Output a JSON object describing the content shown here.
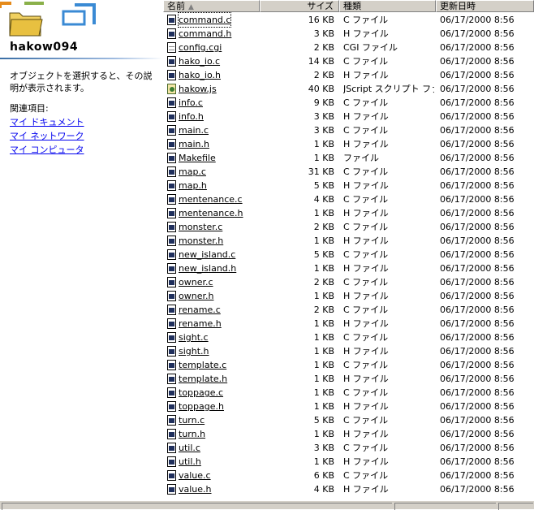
{
  "sidebar": {
    "folder_name": "hakow094",
    "hint": "オブジェクトを選択すると、その説明が表示されます。",
    "related_label": "関連項目:",
    "links": [
      "マイ ドキュメント",
      "マイ ネットワーク",
      "マイ コンピュータ"
    ]
  },
  "list": {
    "headers": {
      "name": "名前",
      "size": "サイズ",
      "type": "種類",
      "date": "更新日時"
    },
    "files": [
      {
        "name": "command.c",
        "size": "16 KB",
        "type": "C ファイル",
        "date": "06/17/2000 8:56",
        "icon": "doc"
      },
      {
        "name": "command.h",
        "size": "3 KB",
        "type": "H ファイル",
        "date": "06/17/2000 8:56",
        "icon": "doc"
      },
      {
        "name": "config.cgi",
        "size": "2 KB",
        "type": "CGI ファイル",
        "date": "06/17/2000 8:56",
        "icon": "plain"
      },
      {
        "name": "hako_io.c",
        "size": "14 KB",
        "type": "C ファイル",
        "date": "06/17/2000 8:56",
        "icon": "doc"
      },
      {
        "name": "hako_io.h",
        "size": "2 KB",
        "type": "H ファイル",
        "date": "06/17/2000 8:56",
        "icon": "doc"
      },
      {
        "name": "hakow.js",
        "size": "40 KB",
        "type": "JScript スクリプト ファ...",
        "date": "06/17/2000 8:56",
        "icon": "script"
      },
      {
        "name": "info.c",
        "size": "9 KB",
        "type": "C ファイル",
        "date": "06/17/2000 8:56",
        "icon": "doc"
      },
      {
        "name": "info.h",
        "size": "3 KB",
        "type": "H ファイル",
        "date": "06/17/2000 8:56",
        "icon": "doc"
      },
      {
        "name": "main.c",
        "size": "3 KB",
        "type": "C ファイル",
        "date": "06/17/2000 8:56",
        "icon": "doc"
      },
      {
        "name": "main.h",
        "size": "1 KB",
        "type": "H ファイル",
        "date": "06/17/2000 8:56",
        "icon": "doc"
      },
      {
        "name": "Makefile",
        "size": "1 KB",
        "type": "ファイル",
        "date": "06/17/2000 8:56",
        "icon": "doc"
      },
      {
        "name": "map.c",
        "size": "31 KB",
        "type": "C ファイル",
        "date": "06/17/2000 8:56",
        "icon": "doc"
      },
      {
        "name": "map.h",
        "size": "5 KB",
        "type": "H ファイル",
        "date": "06/17/2000 8:56",
        "icon": "doc"
      },
      {
        "name": "mentenance.c",
        "size": "4 KB",
        "type": "C ファイル",
        "date": "06/17/2000 8:56",
        "icon": "doc"
      },
      {
        "name": "mentenance.h",
        "size": "1 KB",
        "type": "H ファイル",
        "date": "06/17/2000 8:56",
        "icon": "doc"
      },
      {
        "name": "monster.c",
        "size": "2 KB",
        "type": "C ファイル",
        "date": "06/17/2000 8:56",
        "icon": "doc"
      },
      {
        "name": "monster.h",
        "size": "1 KB",
        "type": "H ファイル",
        "date": "06/17/2000 8:56",
        "icon": "doc"
      },
      {
        "name": "new_island.c",
        "size": "5 KB",
        "type": "C ファイル",
        "date": "06/17/2000 8:56",
        "icon": "doc"
      },
      {
        "name": "new_island.h",
        "size": "1 KB",
        "type": "H ファイル",
        "date": "06/17/2000 8:56",
        "icon": "doc"
      },
      {
        "name": "owner.c",
        "size": "2 KB",
        "type": "C ファイル",
        "date": "06/17/2000 8:56",
        "icon": "doc"
      },
      {
        "name": "owner.h",
        "size": "1 KB",
        "type": "H ファイル",
        "date": "06/17/2000 8:56",
        "icon": "doc"
      },
      {
        "name": "rename.c",
        "size": "2 KB",
        "type": "C ファイル",
        "date": "06/17/2000 8:56",
        "icon": "doc"
      },
      {
        "name": "rename.h",
        "size": "1 KB",
        "type": "H ファイル",
        "date": "06/17/2000 8:56",
        "icon": "doc"
      },
      {
        "name": "sight.c",
        "size": "1 KB",
        "type": "C ファイル",
        "date": "06/17/2000 8:56",
        "icon": "doc"
      },
      {
        "name": "sight.h",
        "size": "1 KB",
        "type": "H ファイル",
        "date": "06/17/2000 8:56",
        "icon": "doc"
      },
      {
        "name": "template.c",
        "size": "1 KB",
        "type": "C ファイル",
        "date": "06/17/2000 8:56",
        "icon": "doc"
      },
      {
        "name": "template.h",
        "size": "1 KB",
        "type": "H ファイル",
        "date": "06/17/2000 8:56",
        "icon": "doc"
      },
      {
        "name": "toppage.c",
        "size": "1 KB",
        "type": "C ファイル",
        "date": "06/17/2000 8:56",
        "icon": "doc"
      },
      {
        "name": "toppage.h",
        "size": "1 KB",
        "type": "H ファイル",
        "date": "06/17/2000 8:56",
        "icon": "doc"
      },
      {
        "name": "turn.c",
        "size": "5 KB",
        "type": "C ファイル",
        "date": "06/17/2000 8:56",
        "icon": "doc"
      },
      {
        "name": "turn.h",
        "size": "1 KB",
        "type": "H ファイル",
        "date": "06/17/2000 8:56",
        "icon": "doc"
      },
      {
        "name": "util.c",
        "size": "3 KB",
        "type": "C ファイル",
        "date": "06/17/2000 8:56",
        "icon": "doc"
      },
      {
        "name": "util.h",
        "size": "1 KB",
        "type": "H ファイル",
        "date": "06/17/2000 8:56",
        "icon": "doc"
      },
      {
        "name": "value.c",
        "size": "6 KB",
        "type": "C ファイル",
        "date": "06/17/2000 8:56",
        "icon": "doc"
      },
      {
        "name": "value.h",
        "size": "4 KB",
        "type": "H ファイル",
        "date": "06/17/2000 8:56",
        "icon": "doc"
      }
    ]
  },
  "colors": {
    "link": "#0000ee",
    "chrome": "#d4d0c8",
    "accent": "#3a6ea5"
  }
}
